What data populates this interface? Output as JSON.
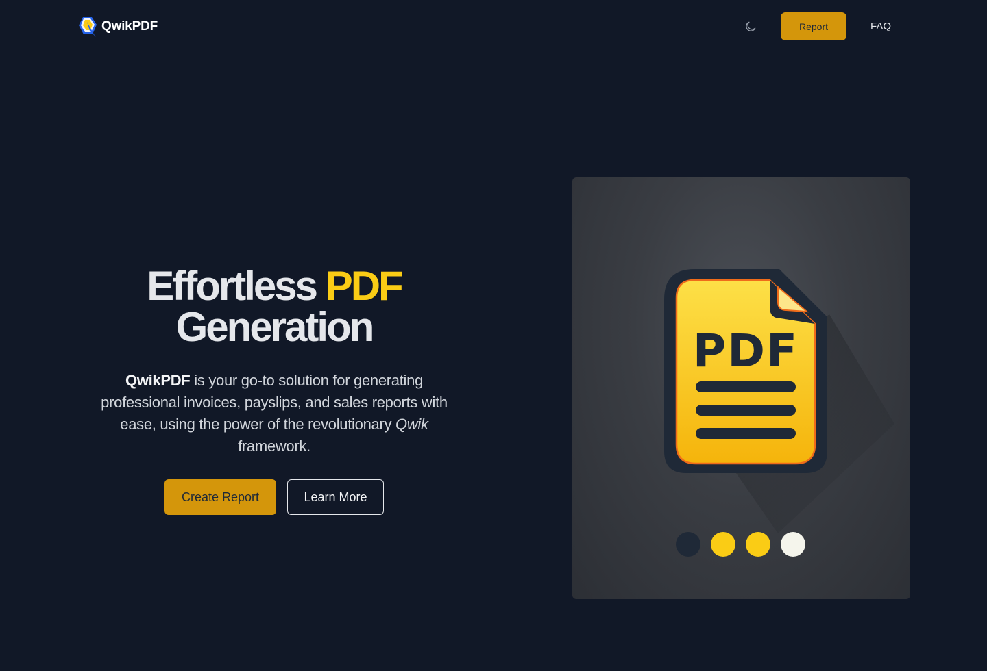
{
  "brand": {
    "name": "QwikPDF"
  },
  "nav": {
    "theme_toggle_icon": "moon-icon",
    "report_label": "Report",
    "faq_label": "FAQ"
  },
  "hero": {
    "title_part1": "Effortless",
    "title_accent": "PDF",
    "title_part2": "Generation",
    "desc_strong": "QwikPDF",
    "desc_text1": " is your go-to solution for generating professional invoices, payslips, and sales reports with ease, using the power of the revolutionary ",
    "desc_em": "Qwik",
    "desc_text2": " framework.",
    "primary_button": "Create Report",
    "secondary_button": "Learn More"
  },
  "illustration": {
    "icon_text": "PDF",
    "dot_colors": [
      "#1f2937",
      "#facc15",
      "#facc15",
      "#f5f5ec"
    ]
  },
  "colors": {
    "background": "#111827",
    "accent": "#facc15",
    "button": "#d4960b"
  }
}
